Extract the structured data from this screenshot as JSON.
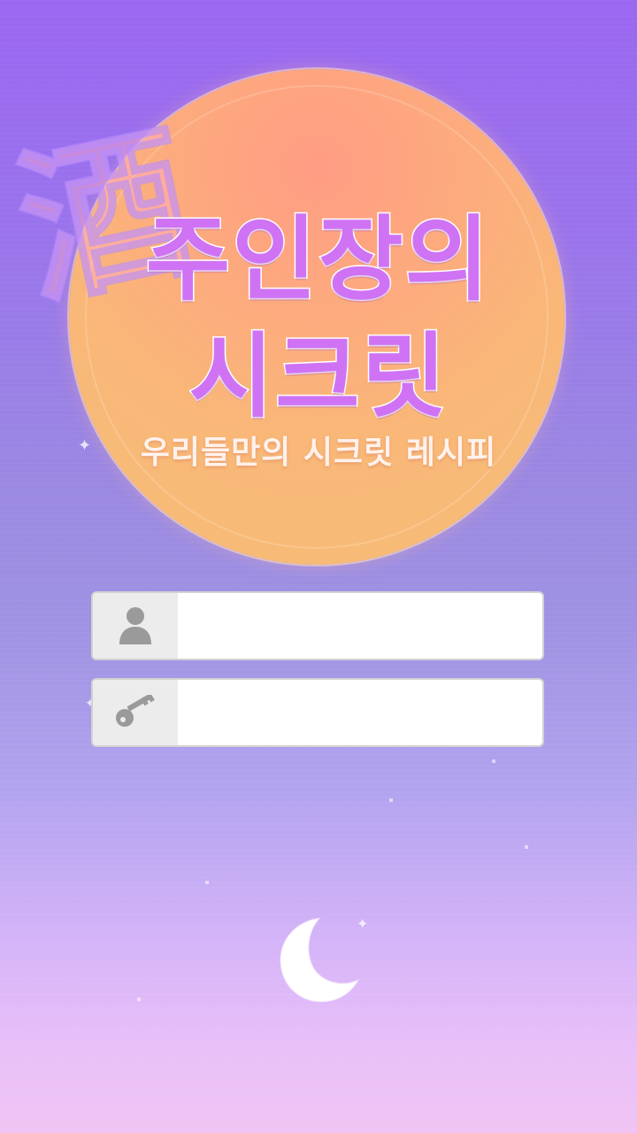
{
  "logo": {
    "kanji": "酒",
    "title_line1": "주인장의",
    "title_line2": "시크릿",
    "subtitle": "우리들만의 시크릿 레시피"
  },
  "login": {
    "username": {
      "value": "",
      "placeholder": "",
      "icon": "user-icon"
    },
    "password": {
      "value": "",
      "placeholder": "",
      "icon": "key-icon"
    }
  },
  "decor": {
    "moon_icon": "crescent-moon-icon"
  },
  "colors": {
    "sky_top": "#9a67f1",
    "sky_bottom": "#f0c4f4",
    "sun": "#fdaa7e",
    "title_fill": "#cf73f4",
    "icon_gray": "#9a9a9a"
  }
}
